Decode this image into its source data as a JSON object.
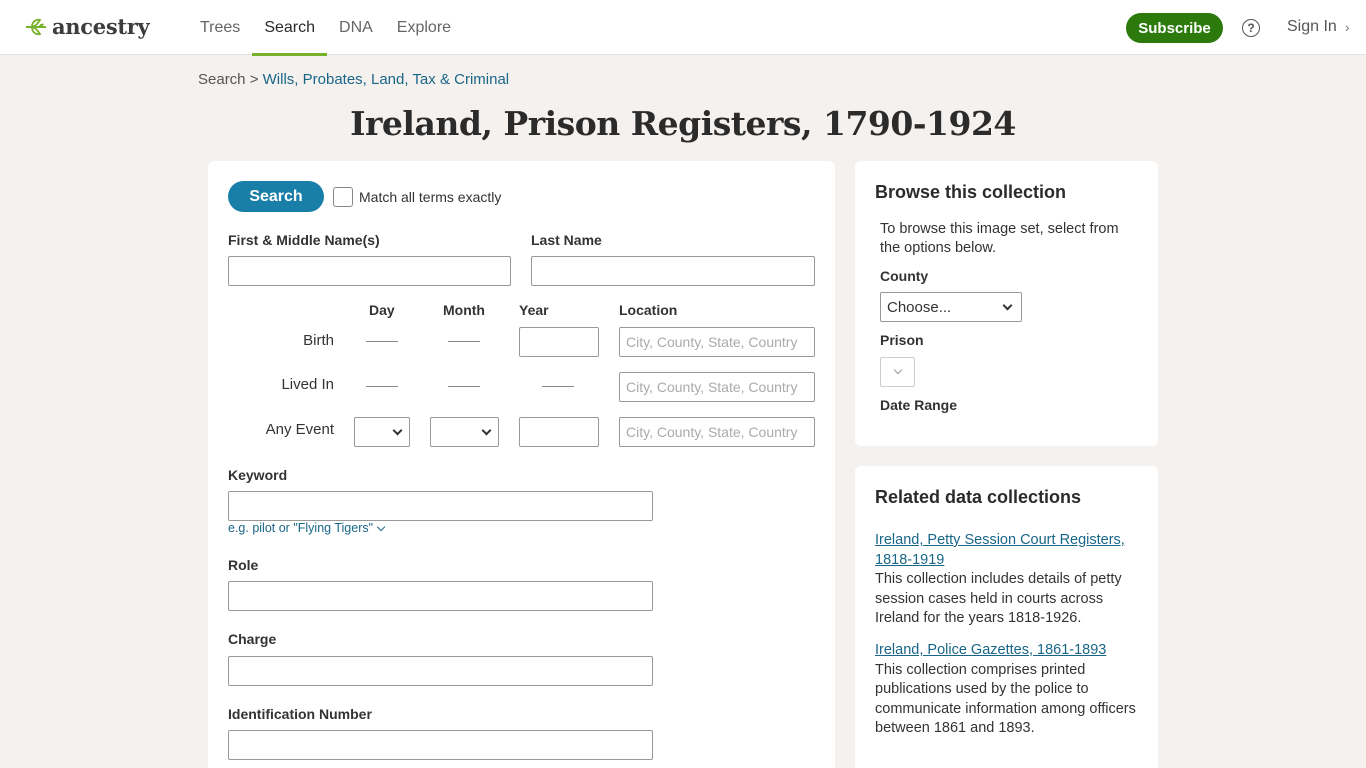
{
  "header": {
    "logo_text": "ancestry",
    "nav": [
      "Trees",
      "Search",
      "DNA",
      "Explore"
    ],
    "active_nav": "Search",
    "subscribe_label": "Subscribe",
    "help_glyph": "?",
    "signin_label": "Sign In",
    "brand_color": "#78b12a",
    "subscribe_color": "#2b7a0b"
  },
  "breadcrumb": {
    "root": "Search",
    "separator": ">",
    "current": "Wills, Probates, Land, Tax & Criminal"
  },
  "page_title": "Ireland, Prison Registers, 1790-1924",
  "search_form": {
    "search_button": "Search",
    "match_exact_label": "Match all terms exactly",
    "first_name_label": "First & Middle Name(s)",
    "last_name_label": "Last Name",
    "columns": {
      "day": "Day",
      "month": "Month",
      "year": "Year",
      "location": "Location"
    },
    "rows": {
      "birth": "Birth",
      "lived_in": "Lived In",
      "any_event": "Any Event"
    },
    "location_placeholder": "City, County, State, Country",
    "keyword_label": "Keyword",
    "keyword_hint": "e.g. pilot or \"Flying Tigers\"",
    "role_label": "Role",
    "charge_label": "Charge",
    "id_number_label": "Identification Number"
  },
  "browse": {
    "title": "Browse this collection",
    "description": "To browse this image set, select from the options below.",
    "county_label": "County",
    "county_value": "Choose...",
    "prison_label": "Prison",
    "date_range_label": "Date Range"
  },
  "related": {
    "title": "Related data collections",
    "items": [
      {
        "link": "Ireland, Petty Session Court Registers, 1818-1919",
        "desc": "This collection includes details of petty session cases held in courts across Ireland for the years 1818-1926."
      },
      {
        "link": "Ireland, Police Gazettes, 1861-1893",
        "desc": "This collection comprises printed publications used by the police to communicate information among officers between 1861 and 1893."
      }
    ]
  }
}
